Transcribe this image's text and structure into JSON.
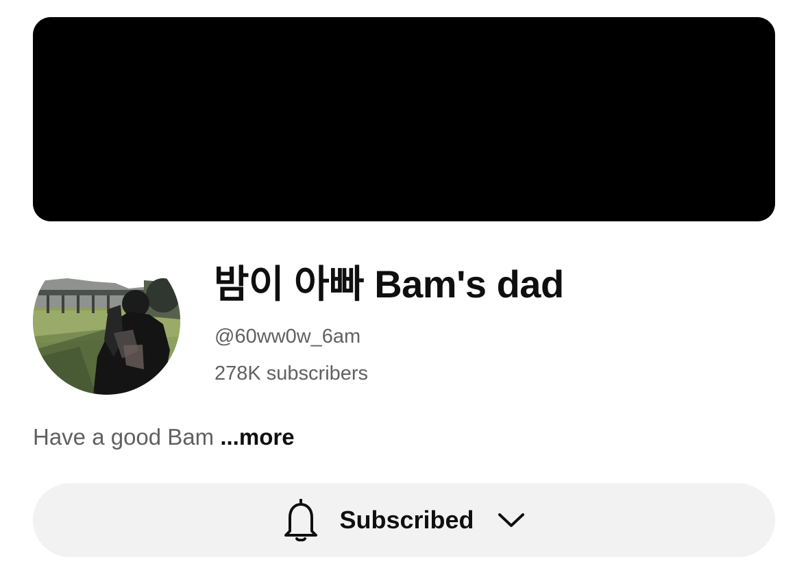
{
  "channel": {
    "name": "밤이 아빠 Bam's dad",
    "handle": "@60ww0w_6am",
    "subscribers": "278K subscribers",
    "description": "Have a good Bam",
    "more_label": "...more"
  },
  "subscribe_button": {
    "label": "Subscribed",
    "icon": "bell-icon",
    "dropdown_icon": "chevron-down-icon"
  },
  "colors": {
    "banner": "#000000",
    "primary_text": "#0f0f0f",
    "secondary_text": "#606060",
    "button_background": "#f2f2f2"
  }
}
